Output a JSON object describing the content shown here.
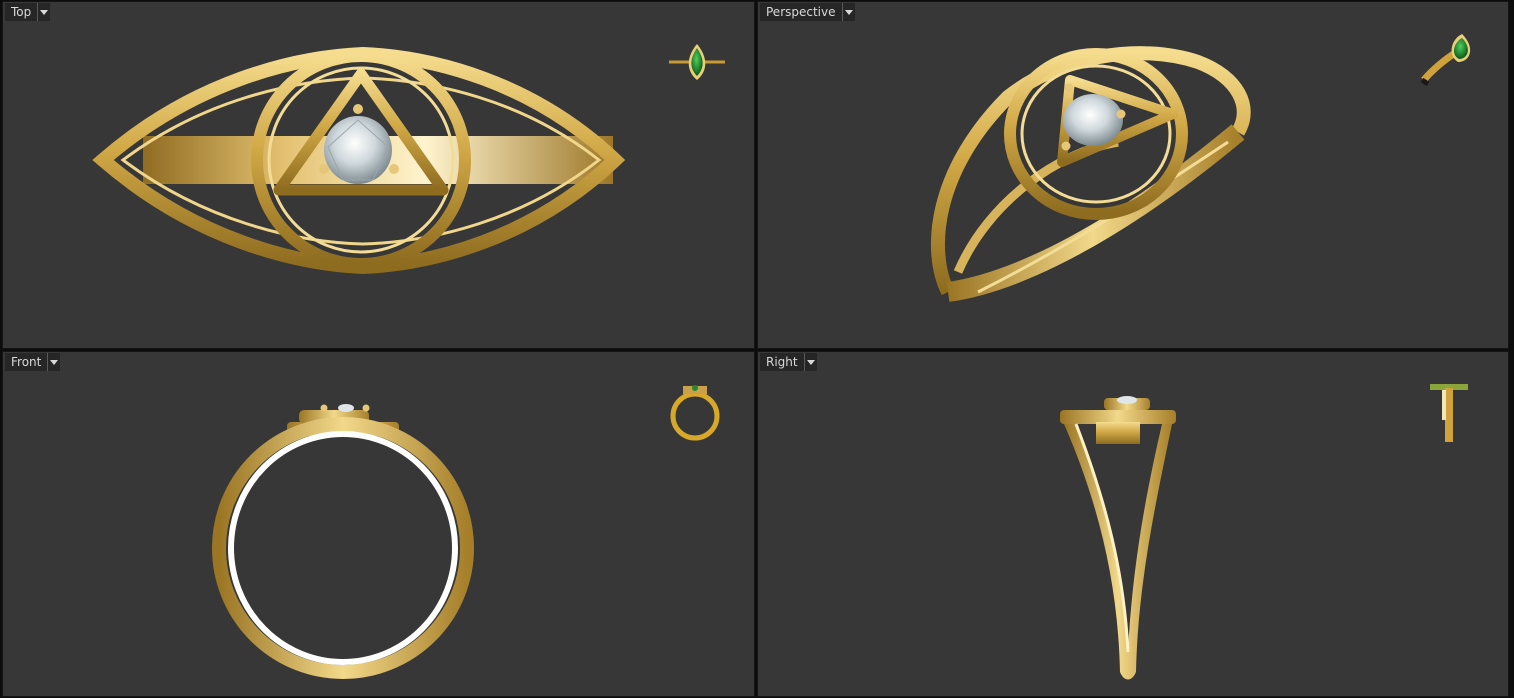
{
  "viewports": {
    "top": {
      "label": "Top",
      "menu_icon": "dropdown-arrow-icon"
    },
    "perspective": {
      "label": "Perspective",
      "menu_icon": "dropdown-arrow-icon"
    },
    "front": {
      "label": "Front",
      "menu_icon": "dropdown-arrow-icon"
    },
    "right": {
      "label": "Right",
      "menu_icon": "dropdown-arrow-icon"
    }
  },
  "colors": {
    "viewport_bg": "#373737",
    "gold": "#d9b04a",
    "gold_light": "#f7e3a0",
    "gold_dark": "#8a6a1c",
    "emerald": "#1f8a2e",
    "diamond": "#dfe6ea"
  },
  "preview_thumbnails": [
    "pear-emerald-ring-icon",
    "pear-emerald-ring-icon",
    "ring-front-icon",
    "ring-side-icon"
  ]
}
